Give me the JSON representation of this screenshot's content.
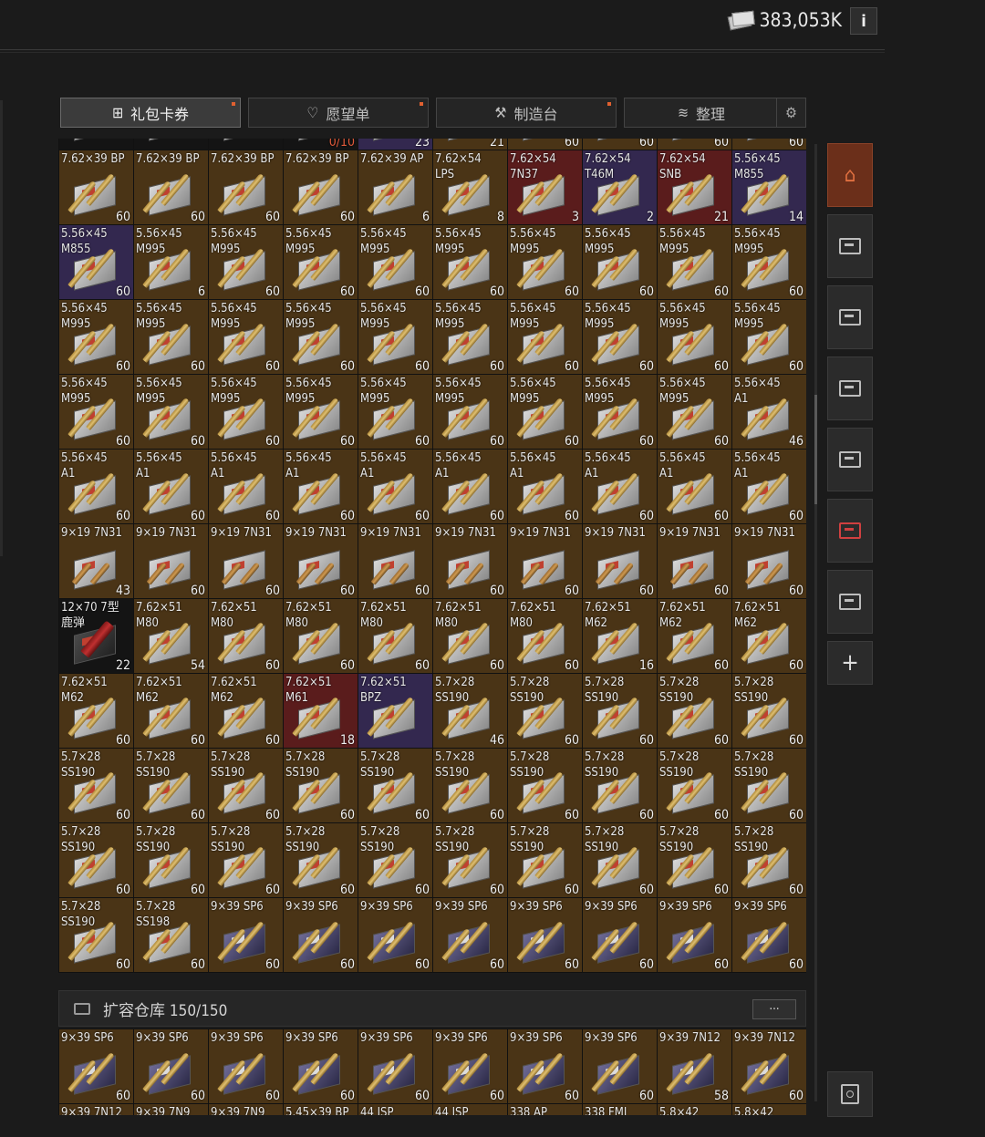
{
  "header": {
    "money": "383,053K",
    "info_label": "i"
  },
  "tabs": [
    {
      "label": "礼包卡券",
      "icon": "gift-icon",
      "active": true
    },
    {
      "label": "愿望单",
      "icon": "heart-icon",
      "active": false
    },
    {
      "label": "制造台",
      "icon": "wrench-icon",
      "active": false
    },
    {
      "label": "整理",
      "icon": "layers-icon",
      "active": false
    }
  ],
  "main_grid": {
    "rows": [
      [
        {
          "n": "",
          "c": "",
          "t": "black"
        },
        {
          "n": "",
          "c": "",
          "t": "black"
        },
        {
          "n": "",
          "c": "",
          "t": "black"
        },
        {
          "n": "",
          "c": "0/10",
          "t": "black"
        },
        {
          "n": "",
          "c": "23",
          "t": "purple"
        },
        {
          "n": "",
          "c": "21",
          "t": "brown"
        },
        {
          "n": "",
          "c": "60",
          "t": "brown"
        },
        {
          "n": "",
          "c": "60",
          "t": "brown"
        },
        {
          "n": "",
          "c": "60",
          "t": "brown"
        },
        {
          "n": "",
          "c": "60",
          "t": "brown"
        }
      ],
      [
        {
          "n": "7.62×39 BP",
          "c": "60",
          "t": "brown"
        },
        {
          "n": "7.62×39 BP",
          "c": "60",
          "t": "brown"
        },
        {
          "n": "7.62×39 BP",
          "c": "60",
          "t": "brown"
        },
        {
          "n": "7.62×39 BP",
          "c": "60",
          "t": "brown"
        },
        {
          "n": "7.62×39 AP",
          "c": "6",
          "t": "brown"
        },
        {
          "n": "7.62×54\nLPS",
          "c": "8",
          "t": "brown"
        },
        {
          "n": "7.62×54\n7N37",
          "c": "3",
          "t": "red"
        },
        {
          "n": "7.62×54\nT46M",
          "c": "2",
          "t": "purple"
        },
        {
          "n": "7.62×54\nSNB",
          "c": "21",
          "t": "red"
        },
        {
          "n": "5.56×45\nM855",
          "c": "14",
          "t": "purple"
        }
      ],
      [
        {
          "n": "5.56×45\nM855",
          "c": "60",
          "t": "purple"
        },
        {
          "n": "5.56×45\nM995",
          "c": "6",
          "t": "brown"
        },
        {
          "n": "5.56×45\nM995",
          "c": "60",
          "t": "brown"
        },
        {
          "n": "5.56×45\nM995",
          "c": "60",
          "t": "brown"
        },
        {
          "n": "5.56×45\nM995",
          "c": "60",
          "t": "brown"
        },
        {
          "n": "5.56×45\nM995",
          "c": "60",
          "t": "brown"
        },
        {
          "n": "5.56×45\nM995",
          "c": "60",
          "t": "brown"
        },
        {
          "n": "5.56×45\nM995",
          "c": "60",
          "t": "brown"
        },
        {
          "n": "5.56×45\nM995",
          "c": "60",
          "t": "brown"
        },
        {
          "n": "5.56×45\nM995",
          "c": "60",
          "t": "brown"
        }
      ],
      [
        {
          "n": "5.56×45\nM995",
          "c": "60",
          "t": "brown"
        },
        {
          "n": "5.56×45\nM995",
          "c": "60",
          "t": "brown"
        },
        {
          "n": "5.56×45\nM995",
          "c": "60",
          "t": "brown"
        },
        {
          "n": "5.56×45\nM995",
          "c": "60",
          "t": "brown"
        },
        {
          "n": "5.56×45\nM995",
          "c": "60",
          "t": "brown"
        },
        {
          "n": "5.56×45\nM995",
          "c": "60",
          "t": "brown"
        },
        {
          "n": "5.56×45\nM995",
          "c": "60",
          "t": "brown"
        },
        {
          "n": "5.56×45\nM995",
          "c": "60",
          "t": "brown"
        },
        {
          "n": "5.56×45\nM995",
          "c": "60",
          "t": "brown"
        },
        {
          "n": "5.56×45\nM995",
          "c": "60",
          "t": "brown"
        }
      ],
      [
        {
          "n": "5.56×45\nM995",
          "c": "60",
          "t": "brown"
        },
        {
          "n": "5.56×45\nM995",
          "c": "60",
          "t": "brown"
        },
        {
          "n": "5.56×45\nM995",
          "c": "60",
          "t": "brown"
        },
        {
          "n": "5.56×45\nM995",
          "c": "60",
          "t": "brown"
        },
        {
          "n": "5.56×45\nM995",
          "c": "60",
          "t": "brown"
        },
        {
          "n": "5.56×45\nM995",
          "c": "60",
          "t": "brown"
        },
        {
          "n": "5.56×45\nM995",
          "c": "60",
          "t": "brown"
        },
        {
          "n": "5.56×45\nM995",
          "c": "60",
          "t": "brown"
        },
        {
          "n": "5.56×45\nM995",
          "c": "60",
          "t": "brown"
        },
        {
          "n": "5.56×45\nA1",
          "c": "46",
          "t": "brown"
        }
      ],
      [
        {
          "n": "5.56×45\nA1",
          "c": "60",
          "t": "brown"
        },
        {
          "n": "5.56×45\nA1",
          "c": "60",
          "t": "brown"
        },
        {
          "n": "5.56×45\nA1",
          "c": "60",
          "t": "brown"
        },
        {
          "n": "5.56×45\nA1",
          "c": "60",
          "t": "brown"
        },
        {
          "n": "5.56×45\nA1",
          "c": "60",
          "t": "brown"
        },
        {
          "n": "5.56×45\nA1",
          "c": "60",
          "t": "brown"
        },
        {
          "n": "5.56×45\nA1",
          "c": "60",
          "t": "brown"
        },
        {
          "n": "5.56×45\nA1",
          "c": "60",
          "t": "brown"
        },
        {
          "n": "5.56×45\nA1",
          "c": "60",
          "t": "brown"
        },
        {
          "n": "5.56×45\nA1",
          "c": "60",
          "t": "brown"
        }
      ],
      [
        {
          "n": "9×19 7N31",
          "c": "43",
          "t": "brown",
          "s": "short"
        },
        {
          "n": "9×19 7N31",
          "c": "60",
          "t": "brown",
          "s": "short"
        },
        {
          "n": "9×19 7N31",
          "c": "60",
          "t": "brown",
          "s": "short"
        },
        {
          "n": "9×19 7N31",
          "c": "60",
          "t": "brown",
          "s": "short"
        },
        {
          "n": "9×19 7N31",
          "c": "60",
          "t": "brown",
          "s": "short"
        },
        {
          "n": "9×19 7N31",
          "c": "60",
          "t": "brown",
          "s": "short"
        },
        {
          "n": "9×19 7N31",
          "c": "60",
          "t": "brown",
          "s": "short"
        },
        {
          "n": "9×19 7N31",
          "c": "60",
          "t": "brown",
          "s": "short"
        },
        {
          "n": "9×19 7N31",
          "c": "60",
          "t": "brown",
          "s": "short"
        },
        {
          "n": "9×19 7N31",
          "c": "60",
          "t": "brown",
          "s": "short"
        }
      ],
      [
        {
          "n": "12×70 7型\n鹿弹",
          "c": "22",
          "t": "black",
          "s": "shell"
        },
        {
          "n": "7.62×51\nM80",
          "c": "54",
          "t": "brown"
        },
        {
          "n": "7.62×51\nM80",
          "c": "60",
          "t": "brown"
        },
        {
          "n": "7.62×51\nM80",
          "c": "60",
          "t": "brown"
        },
        {
          "n": "7.62×51\nM80",
          "c": "60",
          "t": "brown"
        },
        {
          "n": "7.62×51\nM80",
          "c": "60",
          "t": "brown"
        },
        {
          "n": "7.62×51\nM80",
          "c": "60",
          "t": "brown"
        },
        {
          "n": "7.62×51\nM62",
          "c": "16",
          "t": "brown"
        },
        {
          "n": "7.62×51\nM62",
          "c": "60",
          "t": "brown"
        },
        {
          "n": "7.62×51\nM62",
          "c": "60",
          "t": "brown"
        }
      ],
      [
        {
          "n": "7.62×51\nM62",
          "c": "60",
          "t": "brown"
        },
        {
          "n": "7.62×51\nM62",
          "c": "60",
          "t": "brown"
        },
        {
          "n": "7.62×51\nM62",
          "c": "60",
          "t": "brown"
        },
        {
          "n": "7.62×51\nM61",
          "c": "18",
          "t": "red"
        },
        {
          "n": "7.62×51\nBPZ",
          "c": "",
          "t": "purple"
        },
        {
          "n": "5.7×28\nSS190",
          "c": "46",
          "t": "brown"
        },
        {
          "n": "5.7×28\nSS190",
          "c": "60",
          "t": "brown"
        },
        {
          "n": "5.7×28\nSS190",
          "c": "60",
          "t": "brown"
        },
        {
          "n": "5.7×28\nSS190",
          "c": "60",
          "t": "brown"
        },
        {
          "n": "5.7×28\nSS190",
          "c": "60",
          "t": "brown"
        }
      ],
      [
        {
          "n": "5.7×28\nSS190",
          "c": "60",
          "t": "brown"
        },
        {
          "n": "5.7×28\nSS190",
          "c": "60",
          "t": "brown"
        },
        {
          "n": "5.7×28\nSS190",
          "c": "60",
          "t": "brown"
        },
        {
          "n": "5.7×28\nSS190",
          "c": "60",
          "t": "brown"
        },
        {
          "n": "5.7×28\nSS190",
          "c": "60",
          "t": "brown"
        },
        {
          "n": "5.7×28\nSS190",
          "c": "60",
          "t": "brown"
        },
        {
          "n": "5.7×28\nSS190",
          "c": "60",
          "t": "brown"
        },
        {
          "n": "5.7×28\nSS190",
          "c": "60",
          "t": "brown"
        },
        {
          "n": "5.7×28\nSS190",
          "c": "60",
          "t": "brown"
        },
        {
          "n": "5.7×28\nSS190",
          "c": "60",
          "t": "brown"
        }
      ],
      [
        {
          "n": "5.7×28\nSS190",
          "c": "60",
          "t": "brown"
        },
        {
          "n": "5.7×28\nSS190",
          "c": "60",
          "t": "brown"
        },
        {
          "n": "5.7×28\nSS190",
          "c": "60",
          "t": "brown"
        },
        {
          "n": "5.7×28\nSS190",
          "c": "60",
          "t": "brown"
        },
        {
          "n": "5.7×28\nSS190",
          "c": "60",
          "t": "brown"
        },
        {
          "n": "5.7×28\nSS190",
          "c": "60",
          "t": "brown"
        },
        {
          "n": "5.7×28\nSS190",
          "c": "60",
          "t": "brown"
        },
        {
          "n": "5.7×28\nSS190",
          "c": "60",
          "t": "brown"
        },
        {
          "n": "5.7×28\nSS190",
          "c": "60",
          "t": "brown"
        },
        {
          "n": "5.7×28\nSS190",
          "c": "60",
          "t": "brown"
        }
      ],
      [
        {
          "n": "5.7×28\nSS190",
          "c": "60",
          "t": "brown"
        },
        {
          "n": "5.7×28\nSS198",
          "c": "60",
          "t": "brown"
        },
        {
          "n": "9×39 SP6",
          "c": "60",
          "t": "brown",
          "s": "sp"
        },
        {
          "n": "9×39 SP6",
          "c": "60",
          "t": "brown",
          "s": "sp"
        },
        {
          "n": "9×39 SP6",
          "c": "60",
          "t": "brown",
          "s": "sp"
        },
        {
          "n": "9×39 SP6",
          "c": "60",
          "t": "brown",
          "s": "sp"
        },
        {
          "n": "9×39 SP6",
          "c": "60",
          "t": "brown",
          "s": "sp"
        },
        {
          "n": "9×39 SP6",
          "c": "60",
          "t": "brown",
          "s": "sp"
        },
        {
          "n": "9×39 SP6",
          "c": "60",
          "t": "brown",
          "s": "sp"
        },
        {
          "n": "9×39 SP6",
          "c": "60",
          "t": "brown",
          "s": "sp"
        }
      ]
    ]
  },
  "ext_storage": {
    "title": "扩容仓库 150/150",
    "more_label": "···",
    "rows": [
      [
        {
          "n": "9×39 SP6",
          "c": "60",
          "t": "brown",
          "s": "sp"
        },
        {
          "n": "9×39 SP6",
          "c": "60",
          "t": "brown",
          "s": "sp"
        },
        {
          "n": "9×39 SP6",
          "c": "60",
          "t": "brown",
          "s": "sp"
        },
        {
          "n": "9×39 SP6",
          "c": "60",
          "t": "brown",
          "s": "sp"
        },
        {
          "n": "9×39 SP6",
          "c": "60",
          "t": "brown",
          "s": "sp"
        },
        {
          "n": "9×39 SP6",
          "c": "60",
          "t": "brown",
          "s": "sp"
        },
        {
          "n": "9×39 SP6",
          "c": "60",
          "t": "brown",
          "s": "sp"
        },
        {
          "n": "9×39 SP6",
          "c": "60",
          "t": "brown",
          "s": "sp"
        },
        {
          "n": "9×39 7N12",
          "c": "58",
          "t": "brown",
          "s": "sp"
        },
        {
          "n": "9×39 7N12",
          "c": "60",
          "t": "brown",
          "s": "sp"
        }
      ],
      [
        {
          "n": "9×39 7N12",
          "c": "",
          "t": "brown"
        },
        {
          "n": "9×39 7N9",
          "c": "",
          "t": "brown"
        },
        {
          "n": "9×39 7N9",
          "c": "",
          "t": "brown"
        },
        {
          "n": "5.45×39 BP",
          "c": "",
          "t": "brown"
        },
        {
          "n": "44 JSP",
          "c": "",
          "t": "brown"
        },
        {
          "n": "44 JSP",
          "c": "",
          "t": "brown"
        },
        {
          "n": "338 AP",
          "c": "",
          "t": "brown"
        },
        {
          "n": "338 FMJ",
          "c": "",
          "t": "brown"
        },
        {
          "n": "5.8×42",
          "c": "",
          "t": "brown"
        },
        {
          "n": "5.8×42",
          "c": "",
          "t": "brown"
        }
      ]
    ]
  },
  "sidebar": {
    "buttons": [
      {
        "icon": "home-icon",
        "active": true
      },
      {
        "icon": "crate-icon",
        "active": false
      },
      {
        "icon": "crate-icon",
        "active": false
      },
      {
        "icon": "crate-icon",
        "active": false
      },
      {
        "icon": "crate-icon",
        "active": false
      },
      {
        "icon": "crate-alert-icon",
        "active": false
      },
      {
        "icon": "crate-clock-icon",
        "active": false
      }
    ],
    "add_label": "+",
    "bottom_icon": "safe-icon"
  }
}
